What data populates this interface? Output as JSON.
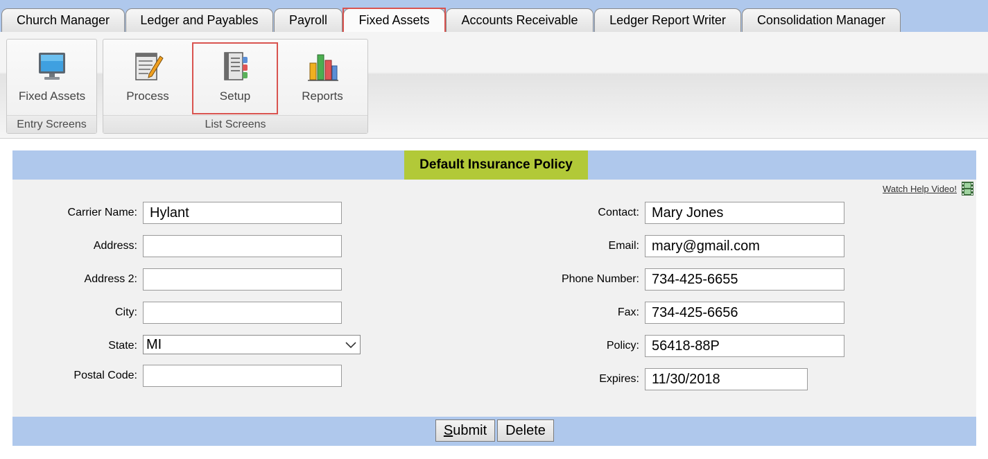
{
  "tabs": [
    {
      "label": "Church Manager"
    },
    {
      "label": "Ledger and Payables"
    },
    {
      "label": "Payroll"
    },
    {
      "label": "Fixed Assets",
      "active": true
    },
    {
      "label": "Accounts Receivable"
    },
    {
      "label": "Ledger Report Writer"
    },
    {
      "label": "Consolidation Manager"
    }
  ],
  "ribbon": {
    "entry_group": {
      "caption": "Entry Screens",
      "buttons": [
        {
          "label": "Fixed Assets",
          "icon": "monitor-icon"
        }
      ]
    },
    "list_group": {
      "caption": "List Screens",
      "buttons": [
        {
          "label": "Process",
          "icon": "notepad-pencil-icon"
        },
        {
          "label": "Setup",
          "icon": "setup-document-icon",
          "selected": true
        },
        {
          "label": "Reports",
          "icon": "bar-chart-icon"
        }
      ]
    }
  },
  "form": {
    "title": "Default Insurance Policy",
    "help_link": "Watch Help Video!",
    "left": {
      "carrier_name": {
        "label": "Carrier Name:",
        "value": "Hylant"
      },
      "address": {
        "label": "Address:",
        "value": ""
      },
      "address2": {
        "label": "Address 2:",
        "value": ""
      },
      "city": {
        "label": "City:",
        "value": ""
      },
      "state": {
        "label": "State:",
        "value": "MI"
      },
      "postal_code": {
        "label": "Postal Code:",
        "value": ""
      }
    },
    "right": {
      "contact": {
        "label": "Contact:",
        "value": "Mary Jones"
      },
      "email": {
        "label": "Email:",
        "value": "mary@gmail.com"
      },
      "phone": {
        "label": "Phone Number:",
        "value": "734-425-6655"
      },
      "fax": {
        "label": "Fax:",
        "value": "734-425-6656"
      },
      "policy": {
        "label": "Policy:",
        "value": "56418-88P"
      },
      "expires": {
        "label": "Expires:",
        "value": "11/30/2018"
      }
    },
    "buttons": {
      "submit_rest": "ubmit",
      "submit_key": "S",
      "delete": "Delete"
    }
  },
  "colors": {
    "tabbar": "#afc8ec",
    "title_bg": "#b2c938",
    "highlight": "#d9534f",
    "panel_bg": "#f1f1f1"
  }
}
